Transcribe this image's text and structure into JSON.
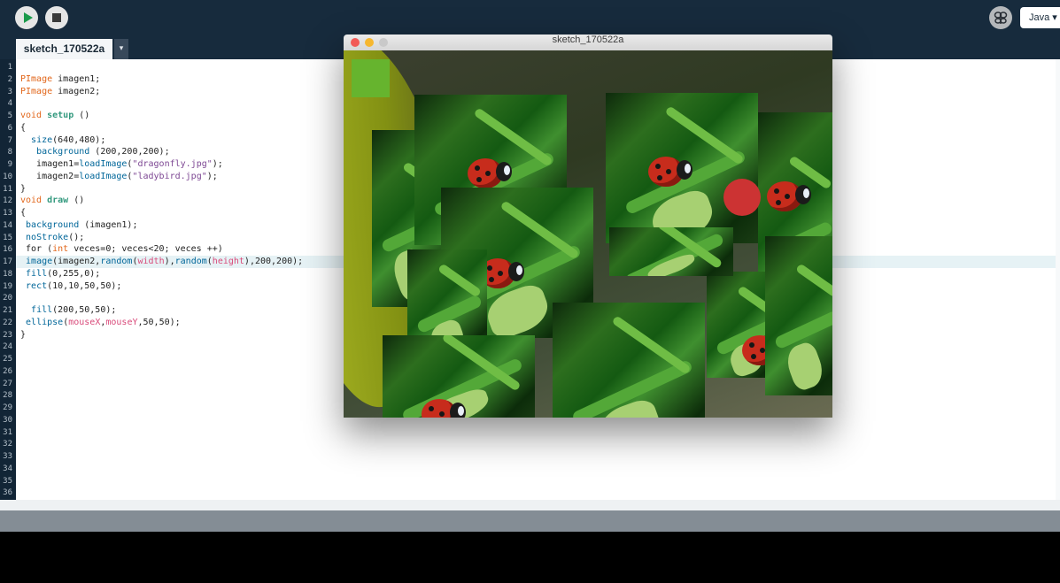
{
  "toolbar": {
    "run_icon": "play-icon",
    "stop_icon": "stop-icon",
    "debug_icon": "butterfly-debugger-icon",
    "mode_label": "Java ▾"
  },
  "tabs": [
    {
      "label": "sketch_170522a",
      "active": true
    }
  ],
  "tab_menu_glyph": "▾",
  "editor": {
    "highlighted_line": 17,
    "line_numbers": [
      "1",
      "2",
      "3",
      "4",
      "5",
      "6",
      "7",
      "8",
      "9",
      "10",
      "11",
      "12",
      "13",
      "14",
      "15",
      "16",
      "17",
      "18",
      "19",
      "20",
      "21",
      "22",
      "23",
      "24",
      "25",
      "26",
      "27",
      "28",
      "29",
      "30",
      "31",
      "32",
      "33",
      "34",
      "35",
      "36"
    ],
    "code_lines": [
      "",
      "PImage imagen1;",
      "PImage imagen2;",
      "",
      "void setup ()",
      "{",
      "  size(640,480);",
      "   background (200,200,200);",
      "   imagen1=loadImage(\"dragonfly.jpg\");",
      "   imagen2=loadImage(\"ladybird.jpg\");",
      "}",
      "void draw ()",
      "{",
      " background (imagen1);",
      " noStroke();",
      " for (int veces=0; veces<20; veces ++)",
      " image(imagen2,random(width),random(height),200,200);",
      " fill(0,255,0);",
      " rect(10,10,50,50);",
      "",
      "  fill(200,50,50);",
      " ellipse(mouseX,mouseY,50,50);",
      "}"
    ]
  },
  "sketch_window": {
    "title": "sketch_170522a",
    "rect_color": "#66b42e",
    "ellipse_color": "#cc3333"
  },
  "colors": {
    "toolbar_bg": "#172b3d",
    "keyword": "#e2661a",
    "function": "#006699",
    "string": "#7d4793",
    "builtin_var": "#d94a7a"
  }
}
